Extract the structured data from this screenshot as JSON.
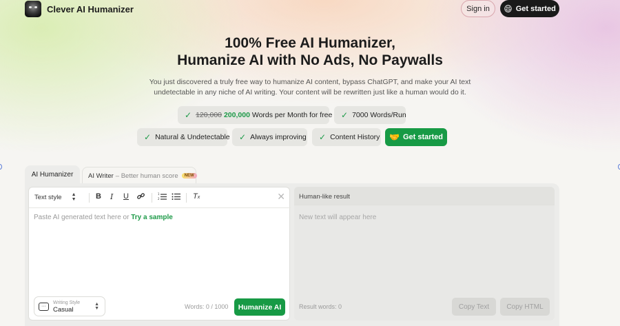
{
  "header": {
    "brand": "Clever AI Humanizer",
    "sign_in": "Sign in",
    "get_started": "Get started"
  },
  "hero": {
    "title_line1": "100% Free AI Humanizer,",
    "title_line2": "Humanize AI with No Ads, No Paywalls",
    "description": "You just discovered a truly free way to humanize AI content, bypass ChatGPT, and make your AI text undetectable in any niche of AI writing. Your content will be rewritten just like a human would do it."
  },
  "features": {
    "old_limit": "120,000",
    "new_limit": "200,000",
    "words_suffix": "Words per Month for free",
    "per_run": "7000 Words/Run",
    "natural": "Natural & Undetectable",
    "improving": "Always improving",
    "history": "Content History",
    "cta": "Get started"
  },
  "tabs": {
    "humanizer": "AI Humanizer",
    "writer": "AI Writer",
    "writer_sub": "– Better human score",
    "new_badge": "NEW"
  },
  "editor": {
    "text_style": "Text style",
    "placeholder": "Paste AI generated text here or",
    "try_sample": "Try a sample",
    "writing_style_label": "Writing Style",
    "writing_style_value": "Casual",
    "word_count": "Words: 0 / 1000",
    "humanize_button": "Humanize AI"
  },
  "result": {
    "header": "Human-like result",
    "placeholder": "New text will appear here",
    "words": "Result words: 0",
    "copy_text": "Copy Text",
    "copy_html": "Copy HTML"
  },
  "colors": {
    "accent_green": "#179a45",
    "dark_button": "#1a1a1a"
  },
  "icons": [
    "app-logo",
    "emoji-icon",
    "check-icon",
    "bold-icon",
    "italic-icon",
    "underline-icon",
    "link-icon",
    "ordered-list-icon",
    "bullet-list-icon",
    "clear-format-icon",
    "close-icon",
    "chat-icon"
  ]
}
